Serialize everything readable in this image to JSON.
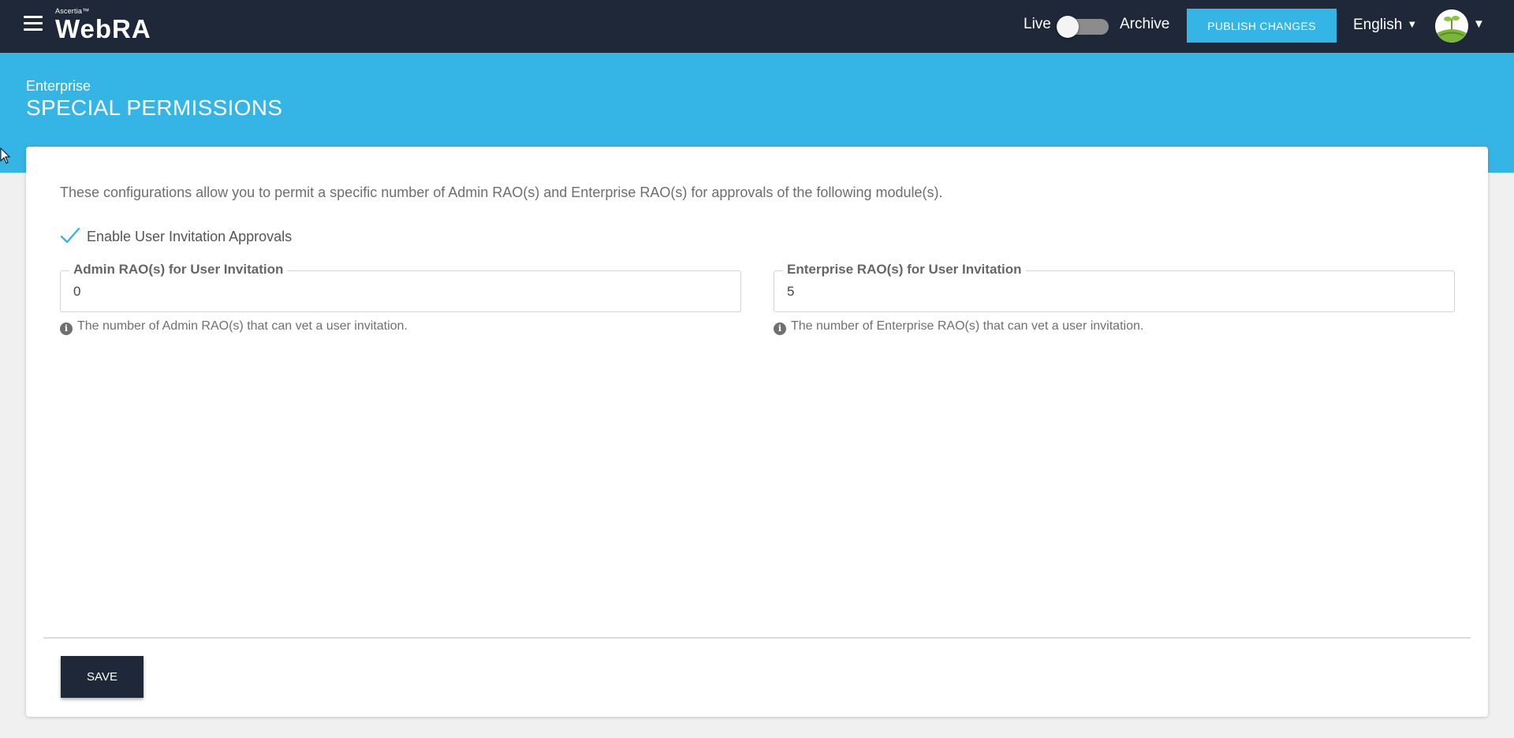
{
  "header": {
    "brand_small": "Ascertia™",
    "brand_main": "WebRA",
    "mode_live_label": "Live",
    "mode_archive_label": "Archive",
    "publish_label": "PUBLISH CHANGES",
    "language": "English",
    "menu_icon": "hamburger-icon",
    "avatar_icon": "avatar-icon"
  },
  "banner": {
    "breadcrumb": "Enterprise",
    "title": "SPECIAL PERMISSIONS"
  },
  "content": {
    "description": "These configurations allow you to permit a specific number of Admin RAO(s) and Enterprise RAO(s) for approvals of the following module(s).",
    "checkbox_label": "Enable User Invitation Approvals",
    "checkbox_checked": true,
    "admin_field": {
      "label": "Admin RAO(s) for User Invitation",
      "value": "0",
      "hint": "The number of Admin RAO(s) that can vet a user invitation."
    },
    "enterprise_field": {
      "label": "Enterprise RAO(s) for User Invitation",
      "value": "5",
      "hint": "The number of Enterprise RAO(s) that can vet a user invitation."
    },
    "save_label": "SAVE"
  },
  "colors": {
    "topbar": "#1e2838",
    "accent": "#35b5e6",
    "save_button": "#1e2838"
  }
}
